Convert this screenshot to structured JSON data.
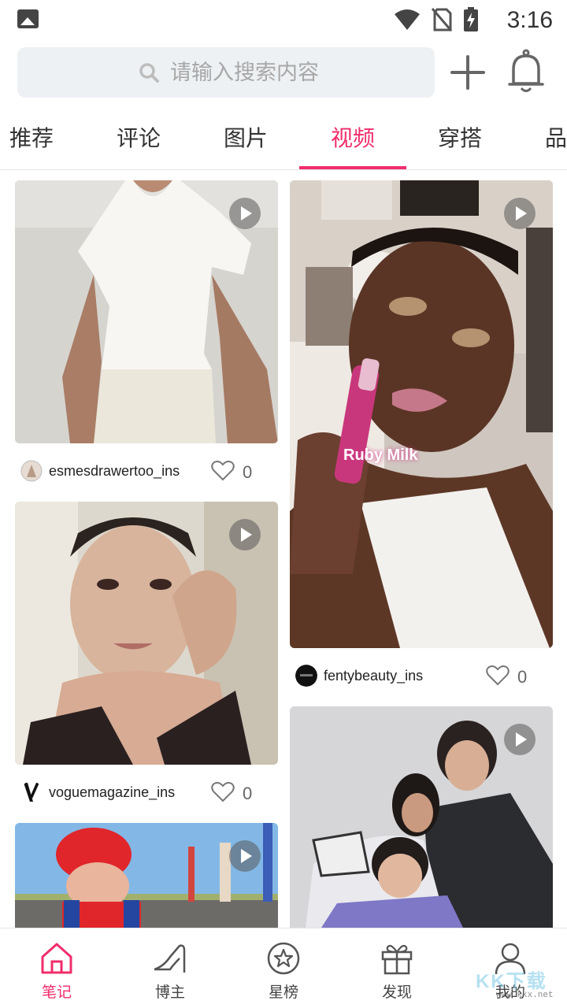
{
  "status_bar": {
    "time": "3:16",
    "icons": [
      "image-notification-icon",
      "wifi-icon",
      "no-sim-icon",
      "battery-charging-icon"
    ]
  },
  "search": {
    "placeholder": "请输入搜索内容"
  },
  "tabs": [
    {
      "label": "推荐",
      "active": false
    },
    {
      "label": "评论",
      "active": false
    },
    {
      "label": "图片",
      "active": false
    },
    {
      "label": "视频",
      "active": true
    },
    {
      "label": "穿搭",
      "active": false
    },
    {
      "label": "品",
      "active": false
    }
  ],
  "feed": {
    "left": [
      {
        "author": "esmesdrawertoo_ins",
        "likes": "0",
        "media": "white-ruffle-top-video"
      },
      {
        "author": "voguemagazine_ins",
        "likes": "0",
        "media": "makeup-portrait-video"
      },
      {
        "author": "",
        "likes": "",
        "media": "red-beret-outdoor-video"
      }
    ],
    "right": [
      {
        "author": "fentybeauty_ins",
        "likes": "0",
        "media": "lip-gloss-video",
        "overlay_text": "Ruby Milk"
      },
      {
        "author": "",
        "likes": "",
        "media": "group-photo-video"
      }
    ]
  },
  "bottom_nav": [
    {
      "label": "笔记",
      "icon": "home-icon",
      "active": true
    },
    {
      "label": "博主",
      "icon": "high-heel-icon",
      "active": false
    },
    {
      "label": "星榜",
      "icon": "star-badge-icon",
      "active": false
    },
    {
      "label": "发现",
      "icon": "gift-icon",
      "active": false
    },
    {
      "label": "我的",
      "icon": "user-icon",
      "active": false
    }
  ],
  "watermark": {
    "text": "KK下载",
    "url": "www.kkx.net"
  },
  "colors": {
    "accent": "#f02d6b",
    "search_bg": "#eef1f4",
    "text": "#222222"
  }
}
